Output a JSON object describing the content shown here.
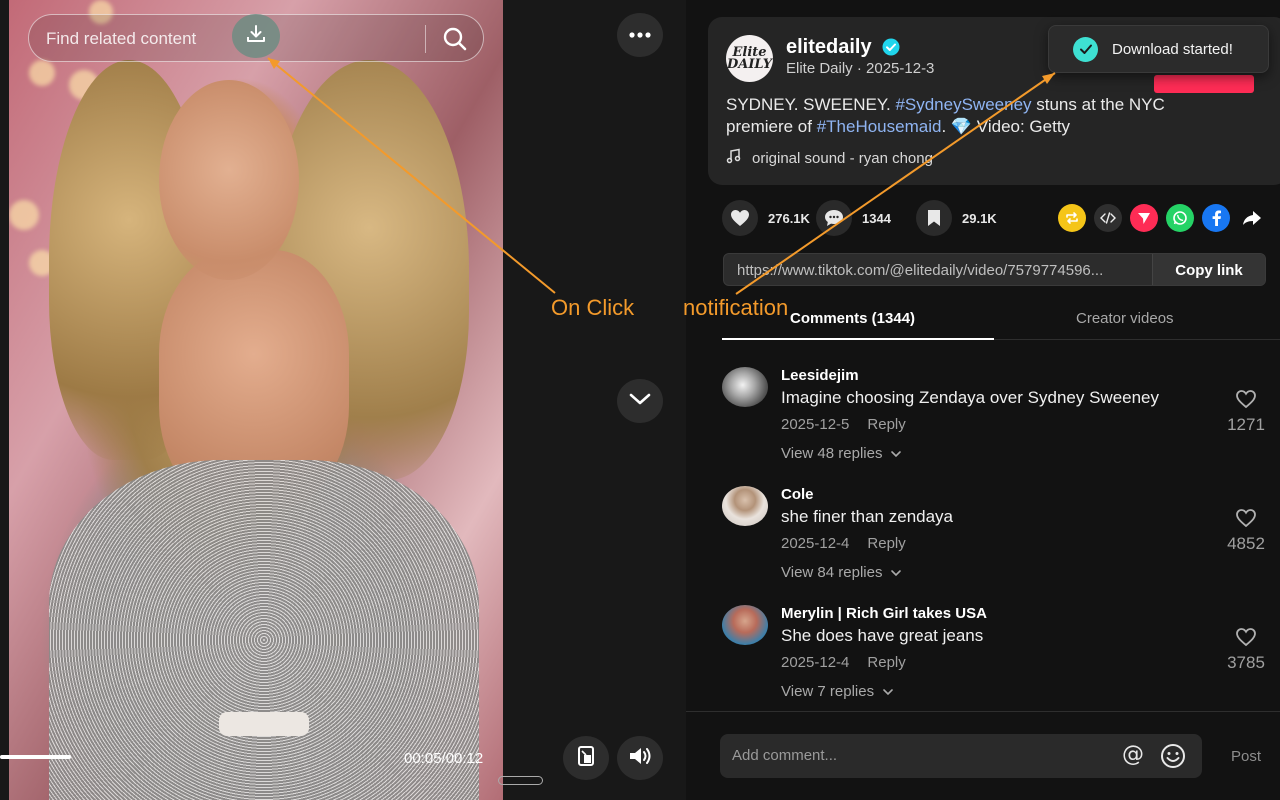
{
  "player": {
    "search_placeholder": "Find related content",
    "time": "00:05/00:12",
    "progress_fraction": 0.42
  },
  "annotations": {
    "on_click": "On Click",
    "notification": "notification"
  },
  "toast": {
    "message": "Download started!"
  },
  "post": {
    "author_name": "elitedaily",
    "author_sub": "Elite Daily · 2025-12-3",
    "avatar_text": "Elite\nDAILY",
    "description_parts": [
      "SYDNEY. SWEENEY. ",
      "#SydneySweeney",
      " stuns at the NYC premiere of ",
      "#TheHousemaid",
      ". ",
      "💎",
      " Video: Getty"
    ],
    "music": "original sound - ryan chong",
    "likes": "276.1K",
    "comments": "1344",
    "saves": "29.1K",
    "link": "https://www.tiktok.com/@elitedaily/video/7579774596...",
    "copy_label": "Copy link"
  },
  "tabs": {
    "comments": "Comments (1344)",
    "creator": "Creator videos"
  },
  "comments": [
    {
      "user": "Leesidejim",
      "text": "Imagine choosing Zendaya over Sydney Sweeney",
      "date": "2025-12-5",
      "reply": "Reply",
      "view": "View 48 replies",
      "likes": "1271"
    },
    {
      "user": "Cole",
      "text": "she finer than zendaya",
      "date": "2025-12-4",
      "reply": "Reply",
      "view": "View 84 replies",
      "likes": "4852"
    },
    {
      "user": "Merylin | Rich Girl takes USA",
      "text": "She does have great jeans",
      "date": "2025-12-4",
      "reply": "Reply",
      "view": "View 7 replies",
      "likes": "3785"
    }
  ],
  "composer": {
    "placeholder": "Add comment...",
    "at_symbol": "@",
    "post_label": "Post"
  },
  "colors": {
    "accent_red": "#fe2c55",
    "annotation_orange": "#f39a2b",
    "hashtag_blue": "#8fb4f2",
    "toast_check": "#3ee0d2"
  }
}
